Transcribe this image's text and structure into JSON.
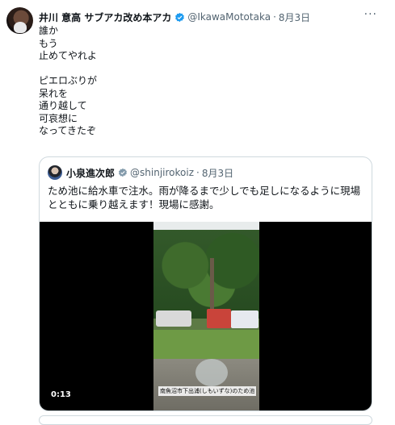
{
  "tweet": {
    "display_name": "井川 意高 サブアカ改め本アカ",
    "handle": "@IkawaMototaka",
    "separator": "·",
    "date": "8月3日",
    "more": "···",
    "lines": [
      "誰か",
      "もう",
      "止めてやれよ",
      "",
      "ピエロぶりが",
      "呆れを",
      "通り越して",
      "可哀想に",
      "なってきたぞ"
    ]
  },
  "quote": {
    "display_name": "小泉進次郎",
    "handle": "@shinjirokoiz",
    "separator": "·",
    "date": "8月3日",
    "text": "ため池に給水車で注水。雨が降るまで少しでも足しになるように現場とともに乗り越えます！現場に感謝。",
    "video": {
      "timestamp": "0:13",
      "caption": "南魚沼市下出浦(しもいずな)のため池"
    }
  },
  "colors": {
    "verified_blue": "#1d9bf0",
    "gov_gray": "#829aab",
    "secondary_text": "#536471"
  },
  "icons": {
    "verified": "verified-badge-icon",
    "government": "government-badge-icon",
    "more": "more-icon"
  }
}
